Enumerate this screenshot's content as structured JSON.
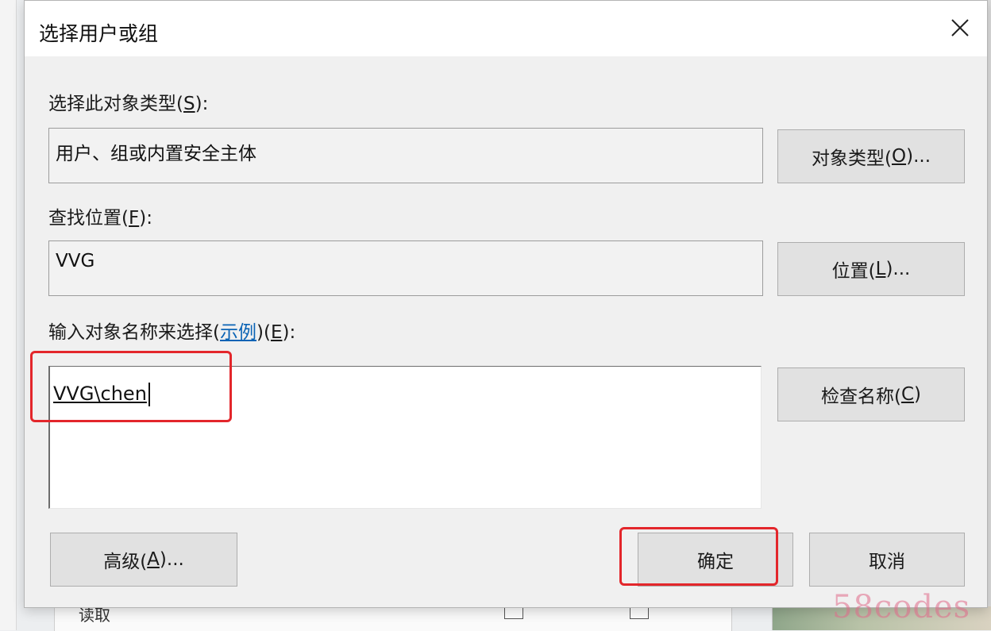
{
  "dialog": {
    "title": "选择用户或组",
    "object_type": {
      "label_pre": "选择此对象类型(",
      "label_key": "S",
      "label_post": "):",
      "value": "用户、组或内置安全主体",
      "button_pre": "对象类型(",
      "button_key": "O",
      "button_post": ")..."
    },
    "location": {
      "label_pre": "查找位置(",
      "label_key": "F",
      "label_post": "):",
      "value": "VVG",
      "button_pre": "位置(",
      "button_key": "L",
      "button_post": ")..."
    },
    "names": {
      "label_pre": "输入对象名称来选择(",
      "label_link": "示例",
      "label_mid": ")(",
      "label_key": "E",
      "label_post": "):",
      "value": "VVG\\chen",
      "check_pre": "检查名称(",
      "check_key": "C",
      "check_post": ")"
    },
    "advanced": {
      "pre": "高级(",
      "key": "A",
      "post": ")..."
    },
    "ok_label": "确定",
    "cancel_label": "取消"
  },
  "background": {
    "list_item": "读取"
  },
  "watermark": "58codes",
  "colors": {
    "highlight_box": "#e3262b",
    "link": "#0a63b5"
  }
}
